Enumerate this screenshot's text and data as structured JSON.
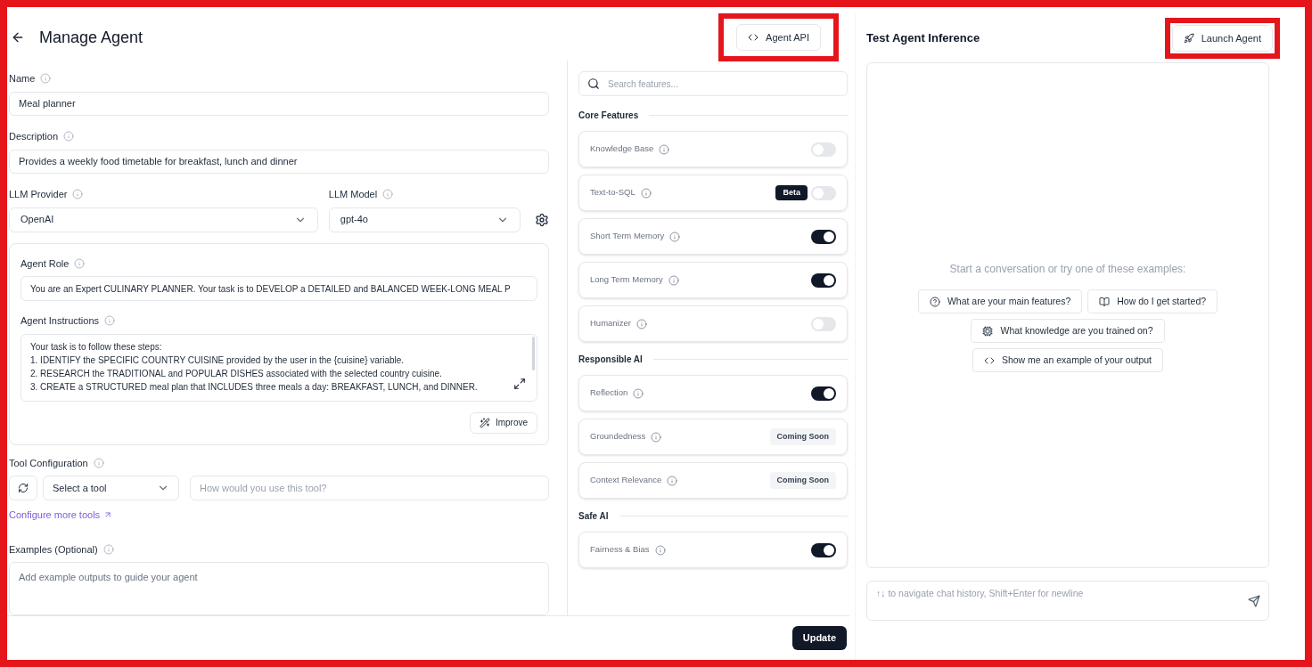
{
  "frame": {
    "highlighted": true
  },
  "header": {
    "title": "Manage Agent",
    "agent_api": {
      "label": "Agent API",
      "highlighted": true
    }
  },
  "form": {
    "name": {
      "label": "Name",
      "value": "Meal planner"
    },
    "description": {
      "label": "Description",
      "value": "Provides a weekly food timetable for breakfast, lunch and dinner"
    },
    "llm_provider": {
      "label": "LLM Provider",
      "value": "OpenAI"
    },
    "llm_model": {
      "label": "LLM Model",
      "value": "gpt-4o"
    },
    "agent_role": {
      "label": "Agent Role",
      "value": "You are an Expert CULINARY PLANNER. Your task is to DEVELOP a DETAILED and BALANCED WEEK-LONG MEAL P"
    },
    "agent_instructions": {
      "label": "Agent Instructions",
      "lines": [
        "Your task is to follow these steps:",
        "1. IDENTIFY the SPECIFIC COUNTRY CUISINE provided by the user in the {cuisine} variable.",
        "2. RESEARCH the TRADITIONAL and POPULAR DISHES associated with the selected country cuisine.",
        "3. CREATE a STRUCTURED meal plan that INCLUDES three meals a day: BREAKFAST, LUNCH, and DINNER."
      ]
    },
    "improve_button": "Improve",
    "tool_configuration": {
      "label": "Tool Configuration",
      "tool_select": "Select a tool",
      "usage_placeholder": "How would you use this tool?",
      "link": "Configure more tools"
    },
    "examples": {
      "label": "Examples (Optional)",
      "placeholder": "Add example outputs to guide your agent"
    }
  },
  "features": {
    "search_placeholder": "Search features...",
    "sections": [
      {
        "title": "Core Features",
        "items": [
          {
            "label": "Knowledge Base",
            "kind": "toggle",
            "on": false
          },
          {
            "label": "Text-to-SQL",
            "kind": "toggle",
            "on": false,
            "badge": "Beta"
          },
          {
            "label": "Short Term Memory",
            "kind": "toggle",
            "on": true
          },
          {
            "label": "Long Term Memory",
            "kind": "toggle",
            "on": true
          },
          {
            "label": "Humanizer",
            "kind": "toggle",
            "on": false
          }
        ]
      },
      {
        "title": "Responsible AI",
        "items": [
          {
            "label": "Reflection",
            "kind": "toggle",
            "on": true
          },
          {
            "label": "Groundedness",
            "kind": "status",
            "status": "Coming Soon"
          },
          {
            "label": "Context Relevance",
            "kind": "status",
            "status": "Coming Soon"
          }
        ]
      },
      {
        "title": "Safe AI",
        "items": [
          {
            "label": "Fairness & Bias",
            "kind": "toggle",
            "on": true
          }
        ]
      }
    ]
  },
  "update_button": "Update",
  "inference": {
    "title": "Test Agent Inference",
    "launch": {
      "label": "Launch Agent",
      "highlighted": true
    },
    "prompt": "Start a conversation or try one of these examples:",
    "suggestions": [
      {
        "label": "What are your main features?",
        "kind": "help"
      },
      {
        "label": "How do I get started?",
        "kind": "book"
      },
      {
        "label": "What knowledge are you trained on?",
        "kind": "chip"
      },
      {
        "label": "Show me an example of your output",
        "kind": "code"
      }
    ],
    "input_placeholder": "↑↓ to navigate chat history, Shift+Enter for newline"
  }
}
